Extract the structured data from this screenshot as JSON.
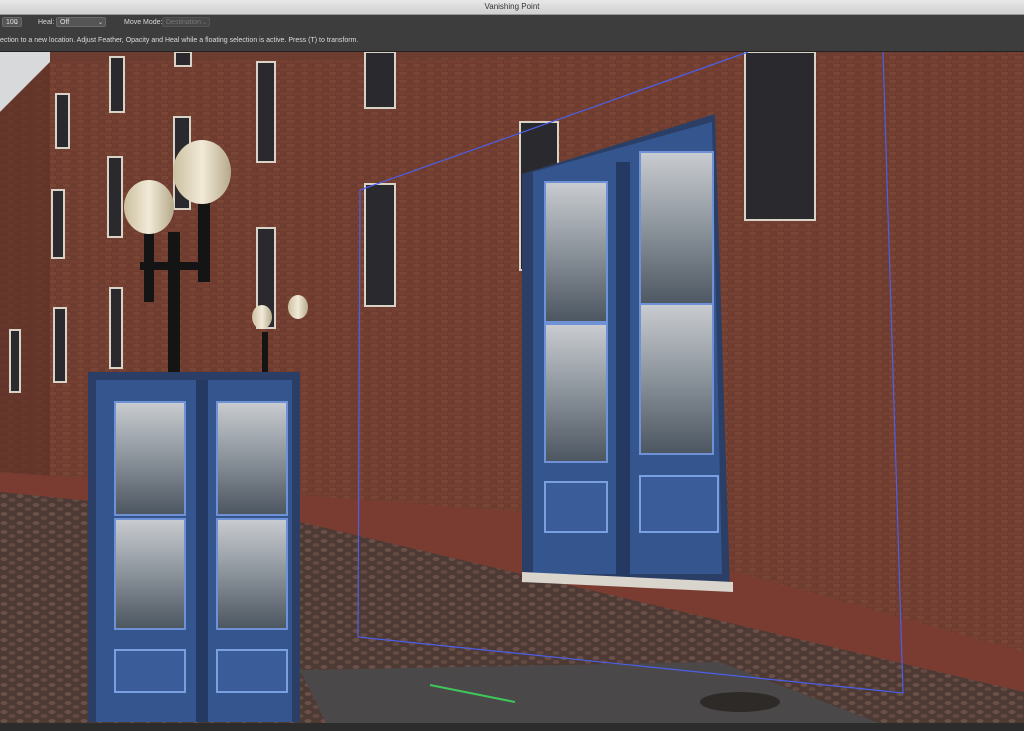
{
  "window": {
    "title": "Vanishing Point"
  },
  "options_bar": {
    "opacity_value": "100",
    "heal_label": "Heal:",
    "heal_value": "Off",
    "move_mode_label": "Move Mode:",
    "move_mode_value": "Destination"
  },
  "hint": {
    "text": "ection to a new location. Adjust Feather, Opacity and Heal while a floating selection is active. Press (T) to transform."
  },
  "colors": {
    "plane_grid": "#4b5fe8",
    "brick": "#6d3c30",
    "door_blue": "#2e4f8c"
  }
}
